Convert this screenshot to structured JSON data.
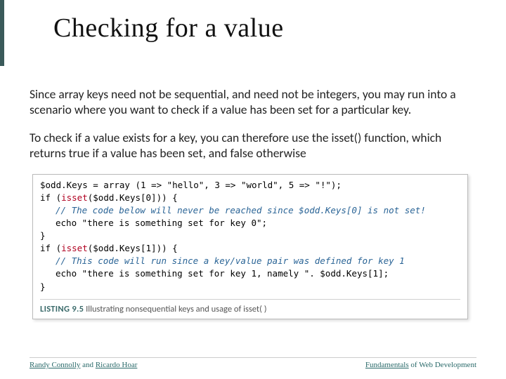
{
  "title": "Checking for a value",
  "para1": "Since array keys need not be sequential, and need not be integers, you may run into a scenario where you want to check if a value has been set for a particular key.",
  "para2": "To check if a value exists for a key, you can therefore use the isset() function, which returns true if a value has been set, and false otherwise",
  "code": {
    "l1": "$odd.Keys = array (1 => \"hello\", 3 => \"world\", 5 => \"!\");",
    "l2a": "if (",
    "l2b": "isset",
    "l2c": "($odd.Keys[0])) {",
    "l3": "// The code below will never be reached since $odd.Keys[0] is not set!",
    "l4": "echo \"there is something set for key 0\";",
    "l5": "}",
    "l6a": "if (",
    "l6b": "isset",
    "l6c": "($odd.Keys[1])) {",
    "l7": "// This code will run since a key/value pair was defined for key 1",
    "l8": "echo \"there is something set for key 1, namely \". $odd.Keys[1];",
    "l9": "}"
  },
  "listing": {
    "label": "LISTING 9.5",
    "text": " Illustrating nonsequential keys and usage of isset( )"
  },
  "footer": {
    "left_a": "Randy Connolly",
    "left_b": " and ",
    "left_c": "Ricardo Hoar",
    "right_a": "Fundamentals",
    "right_b": " of Web Development"
  }
}
